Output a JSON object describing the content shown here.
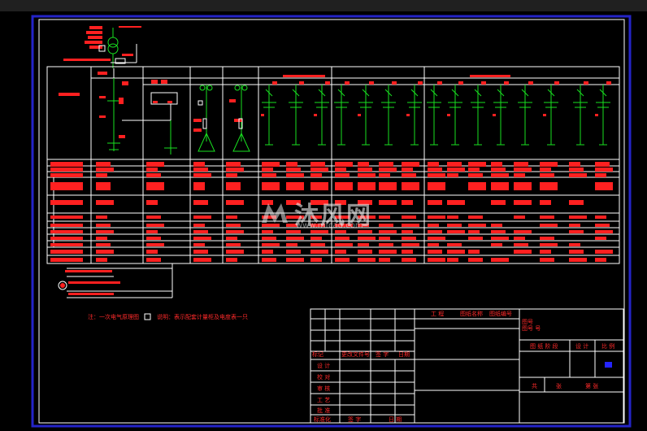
{
  "watermark": {
    "brand": "沐风网",
    "url": "www.mfcad.com"
  },
  "colors": {
    "background": "#000000",
    "frame": "#ffffff",
    "blue_frame": "#2424c8",
    "red": "#ff2020",
    "green": "#18e020"
  },
  "title_block": {
    "row1_a": "工 程",
    "row1_b": "图纸名称",
    "row1_c": "图纸编号",
    "side_a": "图号",
    "side_b": "图号 号",
    "stage_1": "图 纸 阶 段",
    "stage_2": "设 计",
    "stage_3": "比 例",
    "mark_left": "共",
    "mark_mid": "张",
    "mark_right": "第 张",
    "hdr_1": "标记",
    "hdr_2": "更改文件号",
    "hdr_3": "签 字",
    "hdr_4": "日期",
    "sign_1": "设 计",
    "sign_2": "校 对",
    "sign_3": "审 核",
    "sign_4": "工 艺",
    "sign_5": "批 准",
    "sign_6": "标准化",
    "bottom_1": "签 字",
    "bottom_2": "日 期"
  },
  "notes": {
    "note_1": "注：一次电气原理图",
    "note_2": "说明：表示配套计量柜及电度表一只"
  }
}
